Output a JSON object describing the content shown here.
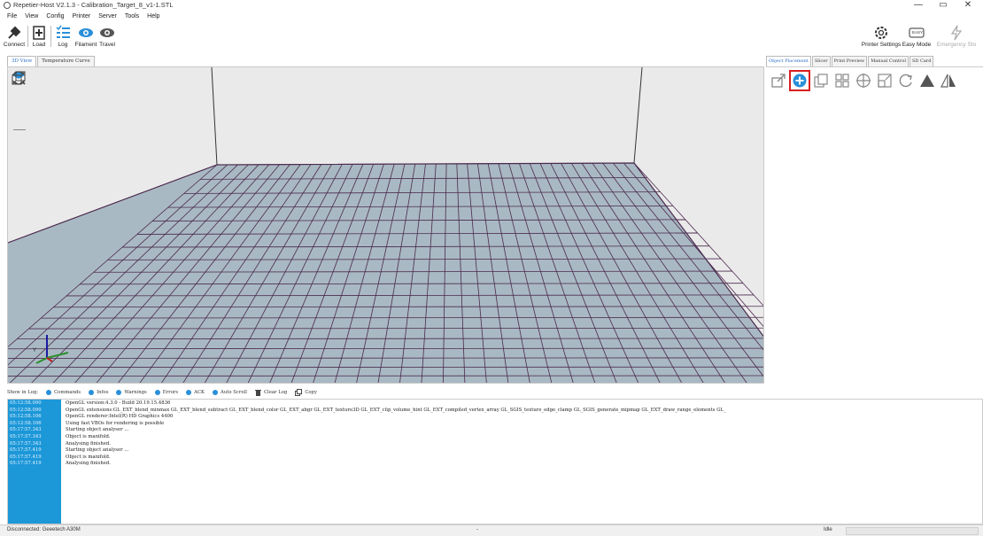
{
  "window": {
    "title": "Repetier-Host V2.1.3 - Calibration_Target_8_v1-1.STL",
    "minimize": "—",
    "maximize": "▭",
    "close": "✕"
  },
  "menu": [
    "File",
    "View",
    "Config",
    "Printer",
    "Server",
    "Tools",
    "Help"
  ],
  "toolbar": {
    "connect": "Connect",
    "load": "Load",
    "log": "Log",
    "filament": "Filament",
    "travel": "Travel",
    "printer_settings": "Printer Settings",
    "easy_mode": "Easy Mode",
    "easy_badge": "EASY",
    "emergency_stop": "Emergency Sto"
  },
  "view_tabs": [
    "3D View",
    "Temperature Curve"
  ],
  "right_tabs": [
    "Object Placement",
    "Slicer",
    "Print Preview",
    "Manual Control",
    "SD Card"
  ],
  "object_tools": [
    "export-icon",
    "add-object-icon",
    "copy-icon",
    "autoposition-icon",
    "center-icon",
    "scale-icon",
    "rotate-icon",
    "cut-icon",
    "mirror-icon"
  ],
  "logbar": {
    "show_in_log": "Show in Log:",
    "commands": "Commands",
    "infos": "Infos",
    "warnings": "Warnings",
    "errors": "Errors",
    "ack": "ACK",
    "auto_scroll": "Auto Scroll",
    "clear_log": "Clear Log",
    "copy": "Copy"
  },
  "log": [
    {
      "ts": "05:12:58.090",
      "msg": "OpenGL version:4.3.0 - Build 20.19.15.4836"
    },
    {
      "ts": "05:12:58.090",
      "msg": "OpenGL extensions:GL_EXT_blend_minmax GL_EXT_blend_subtract GL_EXT_blend_color GL_EXT_abgr GL_EXT_texture3D GL_EXT_clip_volume_hint GL_EXT_compiled_vertex_array GL_SGIS_texture_edge_clamp GL_SGIS_generate_mipmap GL_EXT_draw_range_elements GL_"
    },
    {
      "ts": "05:12:58.106",
      "msg": "OpenGL renderer:Intel(R) HD Graphics 4400"
    },
    {
      "ts": "05:12:58.106",
      "msg": "Using fast VBOs for rendering is possible"
    },
    {
      "ts": "05:17:57.343",
      "msg": "Starting object analyser ..."
    },
    {
      "ts": "05:17:57.343",
      "msg": "Object is manifold."
    },
    {
      "ts": "05:17:57.343",
      "msg": "Analysing finished."
    },
    {
      "ts": "05:17:57.419",
      "msg": "Starting object analyser ..."
    },
    {
      "ts": "05:17:57.419",
      "msg": "Object is manifold."
    },
    {
      "ts": "05:17:57.419",
      "msg": "Analysing finished."
    }
  ],
  "status": {
    "connection": "Disconnected: Geeetech A30M",
    "middle": "-",
    "state": "Idle"
  },
  "axis": {
    "y_label": "Y"
  },
  "colors": {
    "accent": "#2a8fd8",
    "log_gutter": "#1c97d8",
    "bed": "#a9b9c3",
    "grid_line": "#4b2a4e",
    "highlight": "#d92020"
  }
}
